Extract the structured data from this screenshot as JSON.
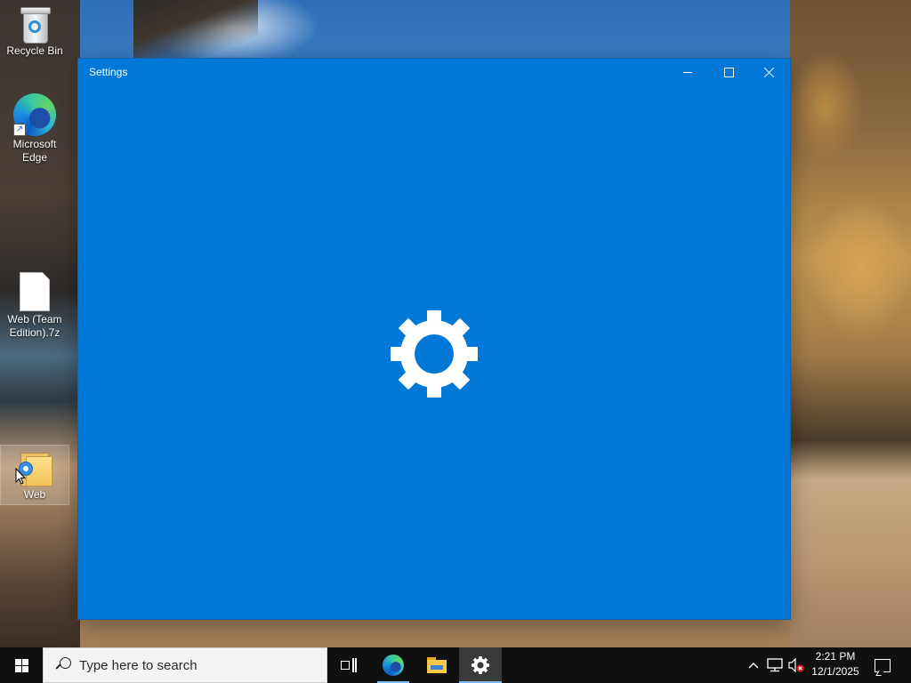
{
  "desktop": {
    "icons": [
      {
        "label": "Recycle Bin",
        "icon": "recycle-bin-icon"
      },
      {
        "label": "Microsoft Edge",
        "icon": "edge-icon"
      },
      {
        "label": "Web (Team Edition).7z",
        "icon": "file-icon"
      },
      {
        "label": "Web",
        "icon": "folder-icon",
        "selected": true
      }
    ]
  },
  "window": {
    "title": "Settings",
    "background": "#0078d7",
    "controls": {
      "minimize": "minimize-icon",
      "maximize": "maximize-icon",
      "close": "close-icon"
    },
    "splash_icon": "gear-icon"
  },
  "taskbar": {
    "background": "#101010",
    "search": {
      "placeholder": "Type here to search"
    },
    "apps": [
      {
        "name": "Task View",
        "icon": "task-view-icon"
      },
      {
        "name": "Microsoft Edge",
        "icon": "edge-icon",
        "running": true
      },
      {
        "name": "File Explorer",
        "icon": "folder-icon"
      },
      {
        "name": "Settings",
        "icon": "gear-icon",
        "active": true
      }
    ],
    "tray": {
      "icons": [
        "chevron-up-icon",
        "network-icon",
        "volume-muted-icon"
      ],
      "time": "2:21 PM",
      "date": "12/1/2025"
    }
  }
}
